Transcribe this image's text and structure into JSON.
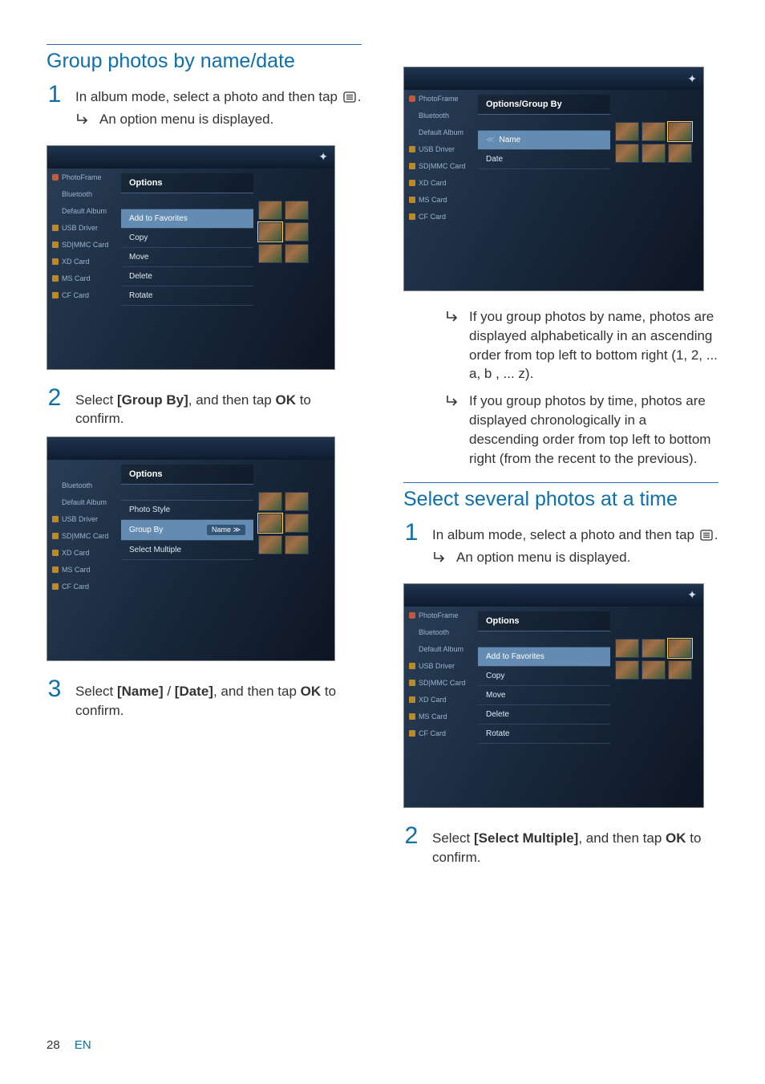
{
  "sections": {
    "group": {
      "title": "Group photos by name/date",
      "step1_a": "In album mode, select a photo and then tap ",
      "step1_b": ".",
      "step1_result": "An option menu is displayed.",
      "step2_a": "Select ",
      "step2_b": "[Group By]",
      "step2_c": ", and then tap ",
      "step2_d": "OK",
      "step2_e": " to confirm.",
      "step3_a": "Select ",
      "step3_b": "[Name]",
      "step3_c": " / ",
      "step3_d": "[Date]",
      "step3_e": ", and then tap ",
      "step3_f": "OK",
      "step3_g": " to confirm.",
      "result_name": "If you group photos by name, photos are displayed alphabetically in an ascending order from top left to bottom right (1, 2, ... a, b , ... z).",
      "result_time": "If you group photos by time, photos are displayed chronologically in a descending order from top left to bottom right (from the recent to the previous)."
    },
    "select": {
      "title": "Select several photos at a time",
      "step1_a": "In album mode, select a photo and then tap ",
      "step1_b": ".",
      "step1_result": "An option menu is displayed.",
      "step2_a": "Select ",
      "step2_b": "[Select Multiple]",
      "step2_c": ", and then tap ",
      "step2_d": "OK",
      "step2_e": " to confirm."
    }
  },
  "screenshots": {
    "sidebar": {
      "photoframe": "PhotoFrame",
      "bluetooth": "Bluetooth",
      "default_album": "Default Album",
      "usb_driver": "USB Driver",
      "sdmmc": "SD|MMC Card",
      "xd": "XD Card",
      "ms": "MS Card",
      "cf": "CF Card"
    },
    "menu1": {
      "header": "Options",
      "add_fav": "Add to Favorites",
      "copy": "Copy",
      "move": "Move",
      "delete": "Delete",
      "rotate": "Rotate"
    },
    "menu2": {
      "header": "Options",
      "photo_style": "Photo Style",
      "group_by": "Group By",
      "group_by_value": "Name",
      "select_multiple": "Select Multiple"
    },
    "menu3": {
      "header": "Options/Group By",
      "name": "Name",
      "date": "Date"
    }
  },
  "footer": {
    "page": "28",
    "lang": "EN"
  },
  "nums": {
    "one": "1",
    "two": "2",
    "three": "3"
  }
}
